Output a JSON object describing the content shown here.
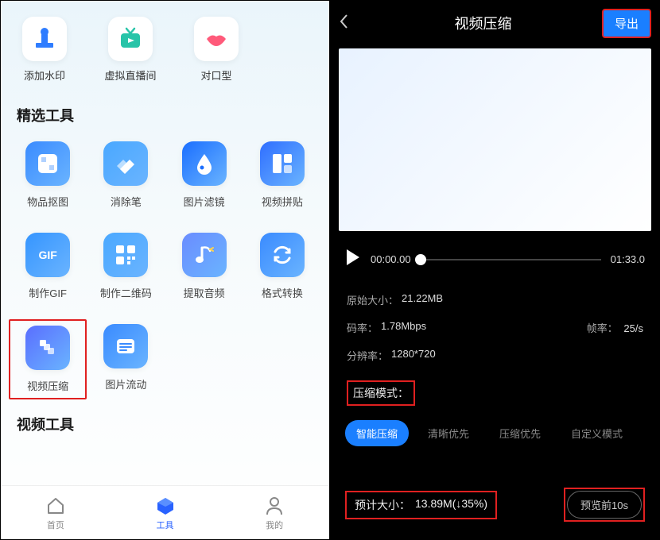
{
  "left": {
    "top_tools": [
      {
        "label": "添加水印",
        "icon": "stamp-icon",
        "color": "#2f7dff"
      },
      {
        "label": "虚拟直播间",
        "icon": "tv-icon",
        "color": "#27c4a8"
      },
      {
        "label": "对口型",
        "icon": "lips-icon",
        "color": "#ff5a7a"
      }
    ],
    "section1_title": "精选工具",
    "featured_tools": [
      {
        "label": "物品抠图",
        "icon": "cutout-icon",
        "bg": "#3a8bff"
      },
      {
        "label": "消除笔",
        "icon": "eraser-icon",
        "bg": "#4aa8ff"
      },
      {
        "label": "图片滤镜",
        "icon": "drop-icon",
        "bg": "#1a6eff"
      },
      {
        "label": "视频拼贴",
        "icon": "collage-icon",
        "bg": "#2f6eff"
      },
      {
        "label": "制作GIF",
        "icon": "gif-icon",
        "bg": "#3595ff",
        "text": "GIF"
      },
      {
        "label": "制作二维码",
        "icon": "qr-icon",
        "bg": "#4aa8ff"
      },
      {
        "label": "提取音频",
        "icon": "audio-icon",
        "bg": "#6a8cff"
      },
      {
        "label": "格式转换",
        "icon": "convert-icon",
        "bg": "#3a8bff"
      },
      {
        "label": "视频压缩",
        "icon": "compress-icon",
        "bg": "#5a6eff",
        "highlight": true
      },
      {
        "label": "图片流动",
        "icon": "flow-icon",
        "bg": "#3a8bff"
      }
    ],
    "section2_title": "视频工具",
    "nav": [
      {
        "label": "首页",
        "icon": "home-icon"
      },
      {
        "label": "工具",
        "icon": "tools-icon",
        "active": true
      },
      {
        "label": "我的",
        "icon": "profile-icon"
      }
    ]
  },
  "right": {
    "title": "视频压缩",
    "export_label": "导出",
    "current_time": "00:00.00",
    "total_time": "01:33.0",
    "original_size_label": "原始大小：",
    "original_size_value": "21.22MB",
    "bitrate_label": "码率：",
    "bitrate_value": "1.78Mbps",
    "fps_label": "帧率：",
    "fps_value": "25/s",
    "resolution_label": "分辨率：",
    "resolution_value": "1280*720",
    "mode_label": "压缩模式：",
    "mode_tabs": [
      "智能压缩",
      "清晰优先",
      "压缩优先",
      "自定义模式"
    ],
    "mode_active_index": 0,
    "estimate_label": "预计大小：",
    "estimate_value": "13.89M(↓35%)",
    "preview_label": "预览前10s"
  }
}
